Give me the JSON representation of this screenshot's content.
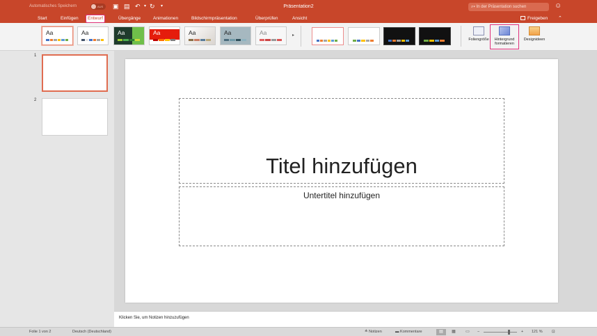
{
  "titlebar": {
    "autosave_label": "Automatisches Speichern",
    "autosave_toggle": "AUS",
    "doc_title": "Präsentation2",
    "search_placeholder": "In der Präsentation suchen",
    "icons": [
      "slides-icon",
      "save-icon",
      "undo-icon",
      "redo-icon",
      "customize-icon"
    ]
  },
  "menu": {
    "tabs": [
      "Start",
      "Einfügen",
      "Entwurf",
      "Übergänge",
      "Animationen",
      "Bildschirmpräsentation",
      "Überprüfen",
      "Ansicht"
    ],
    "active_tab": "Entwurf",
    "share_label": "Freigeben"
  },
  "ribbon": {
    "theme_label": "Aa",
    "buttons": {
      "slide_size": "Foliengröße",
      "format_bg_line1": "Hintergrund",
      "format_bg_line2": "formatieren",
      "design_ideas": "Designideen"
    }
  },
  "thumbnails": [
    {
      "number": "1",
      "selected": true
    },
    {
      "number": "2",
      "selected": false
    }
  ],
  "slide": {
    "title_placeholder": "Titel hinzufügen",
    "subtitle_placeholder": "Untertitel hinzufügen"
  },
  "notes": {
    "placeholder": "Klicken Sie, um Notizen hinzuzufügen"
  },
  "status": {
    "slide_info": "Folie 1 von 2",
    "language": "Deutsch (Deutschland)",
    "notes_label": "Notizen",
    "comments_label": "Kommentare",
    "zoom_minus": "−",
    "zoom_plus": "+",
    "zoom_percent": "121 %"
  },
  "colors": {
    "accent": "#c8462a",
    "highlight": "#e0307a"
  }
}
